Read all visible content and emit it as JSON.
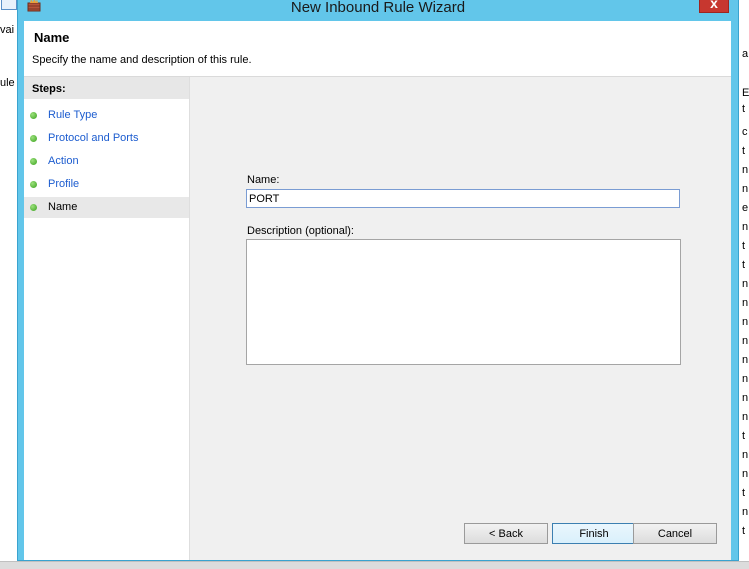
{
  "background": {
    "left_fragments": [
      "vai",
      "ule"
    ],
    "right_fragments": [
      "a",
      "E",
      "t",
      "c",
      "t",
      "n",
      "n",
      "e",
      "n",
      "t",
      "t",
      "n",
      "n",
      "n",
      "n",
      "n",
      "n",
      "n",
      "n",
      "t",
      "n",
      "n",
      "t",
      "n",
      "t"
    ]
  },
  "window": {
    "title": "New Inbound Rule Wizard",
    "close_label": "x"
  },
  "header": {
    "title": "Name",
    "subtitle": "Specify the name and description of this rule."
  },
  "steps": {
    "heading": "Steps:",
    "items": [
      {
        "label": "Rule Type",
        "state": "link"
      },
      {
        "label": "Protocol and Ports",
        "state": "link"
      },
      {
        "label": "Action",
        "state": "link"
      },
      {
        "label": "Profile",
        "state": "link"
      },
      {
        "label": "Name",
        "state": "current"
      }
    ]
  },
  "form": {
    "name_label": "Name:",
    "name_value": "PORT",
    "description_label": "Description (optional):",
    "description_value": ""
  },
  "buttons": {
    "back": "< Back",
    "finish": "Finish",
    "cancel": "Cancel"
  },
  "colors": {
    "titlebar": "#62c6ea",
    "close": "#c7372f",
    "step_dot": "#3aa21e",
    "link": "#1c5ccf"
  }
}
